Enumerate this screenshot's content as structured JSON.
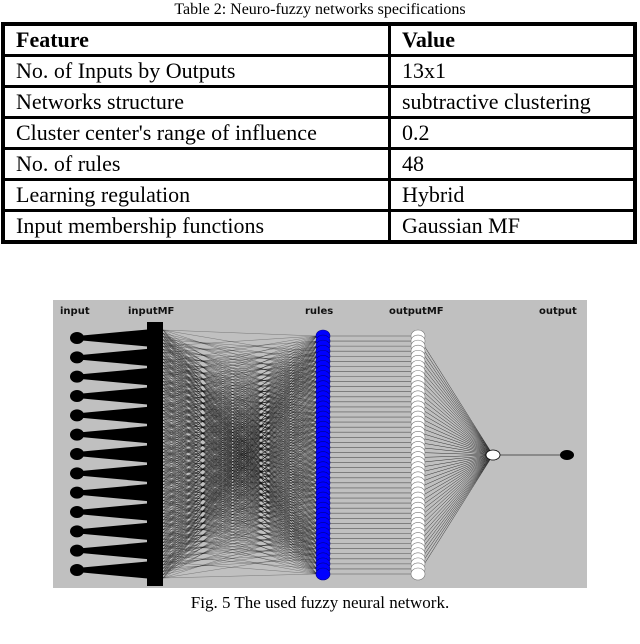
{
  "table": {
    "caption": "Table 2: Neuro-fuzzy networks specifications",
    "headers": [
      "Feature",
      "Value"
    ],
    "rows": [
      [
        "No. of Inputs by Outputs",
        "13x1"
      ],
      [
        "Networks structure",
        "subtractive clustering"
      ],
      [
        "Cluster center's range of influence",
        "0.2"
      ],
      [
        "No. of rules",
        "48"
      ],
      [
        "Learning regulation",
        "Hybrid"
      ],
      [
        "Input membership functions",
        "Gaussian MF"
      ]
    ]
  },
  "figure": {
    "caption": "Fig. 5  The used fuzzy neural network.",
    "layers": {
      "input": "input",
      "inputMF": "inputMF",
      "rules": "rules",
      "outputMF": "outputMF",
      "output": "output"
    },
    "counts": {
      "inputs": 13,
      "rules": 48,
      "outputs": 1
    },
    "colors": {
      "background": "#c0c0c0",
      "input_node": "#000000",
      "rule_node": "#0000ff",
      "outputmf_node": "#ffffff",
      "output_node": "#000000"
    }
  }
}
